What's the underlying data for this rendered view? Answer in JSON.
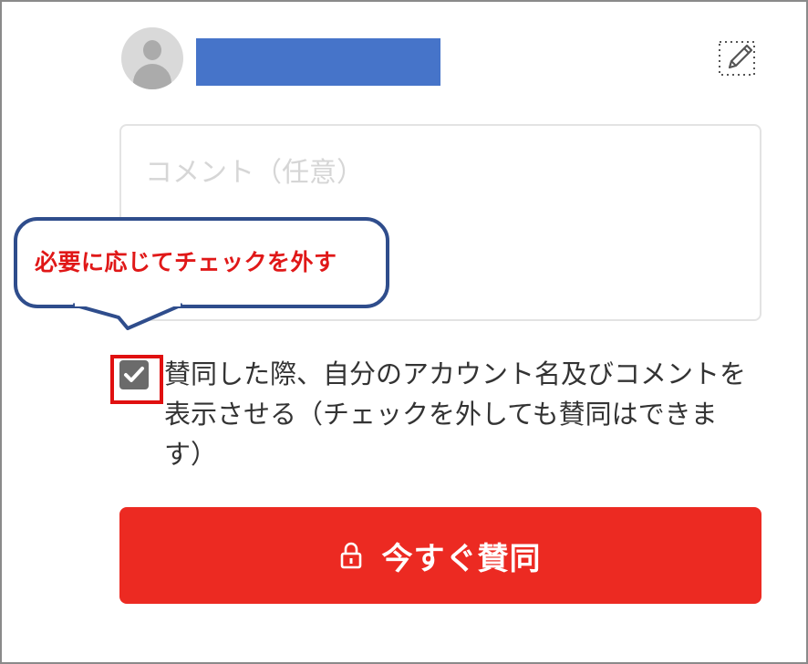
{
  "user": {
    "avatar_icon": "user-avatar-icon",
    "name_redacted_color": "#4674c9"
  },
  "edit": {
    "icon": "edit-pencil-icon"
  },
  "comment": {
    "placeholder": "コメント（任意）",
    "value": ""
  },
  "annotation": {
    "callout_text": "必要に応じてチェックを外す",
    "text_color": "#e01818",
    "border_color": "#2f4d8c",
    "highlight_color": "#e01010"
  },
  "consent": {
    "checked": true,
    "label": "賛同した際、自分のアカウント名及びコメントを表示させる（チェックを外しても賛同はできます）"
  },
  "submit": {
    "icon": "lock-icon",
    "label": "今すぐ賛同",
    "color": "#ec2a22"
  }
}
